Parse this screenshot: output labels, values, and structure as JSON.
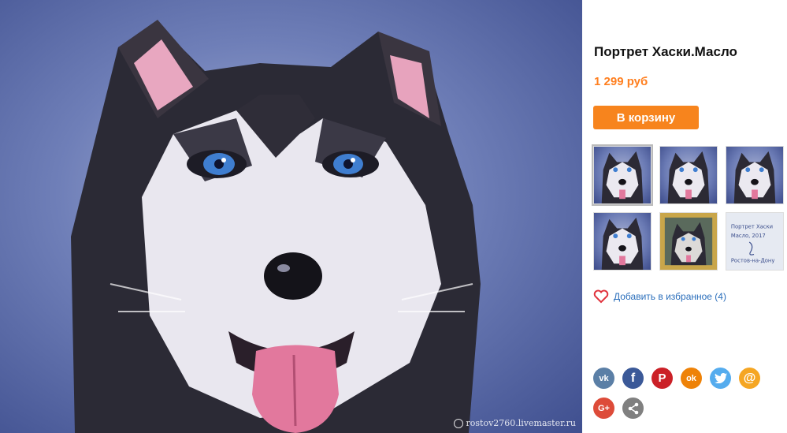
{
  "product": {
    "title": "Портрет Хаски.Масло",
    "price": "1 299 руб",
    "cart_button": "В корзину"
  },
  "favorites": {
    "label": "Добавить в избранное (4)"
  },
  "watermark": {
    "text": "rostov2760.livemaster.ru"
  },
  "thumbnails": [
    {
      "alt": "husky-oil-portrait-1",
      "selected": true
    },
    {
      "alt": "husky-oil-portrait-2",
      "selected": false
    },
    {
      "alt": "husky-oil-portrait-3",
      "selected": false
    },
    {
      "alt": "husky-oil-portrait-4",
      "selected": false
    },
    {
      "alt": "husky-portrait-framed",
      "selected": false
    },
    {
      "alt": "handwritten-note",
      "selected": false,
      "note_lines": [
        "Портрет Хаски",
        "Масло, 2017",
        "Ростов-на-Дону"
      ]
    }
  ],
  "social": [
    {
      "name": "vk",
      "glyph": "vk",
      "color": "#5b7fa6"
    },
    {
      "name": "facebook",
      "glyph": "f",
      "color": "#3b5998"
    },
    {
      "name": "pinterest",
      "glyph": "P",
      "color": "#cb2027"
    },
    {
      "name": "odnoklassniki",
      "glyph": "ok",
      "color": "#ee8208"
    },
    {
      "name": "twitter",
      "glyph": "t",
      "color": "#55acee"
    },
    {
      "name": "mail",
      "glyph": "@",
      "color": "#f5a623"
    },
    {
      "name": "google-plus",
      "glyph": "G+",
      "color": "#dd4b39"
    },
    {
      "name": "share",
      "glyph": "share",
      "color": "#808080"
    }
  ],
  "colors": {
    "accent": "#f7841d",
    "price": "#ff7f1f",
    "link": "#2a6ebb",
    "heart": "#e0323c"
  }
}
